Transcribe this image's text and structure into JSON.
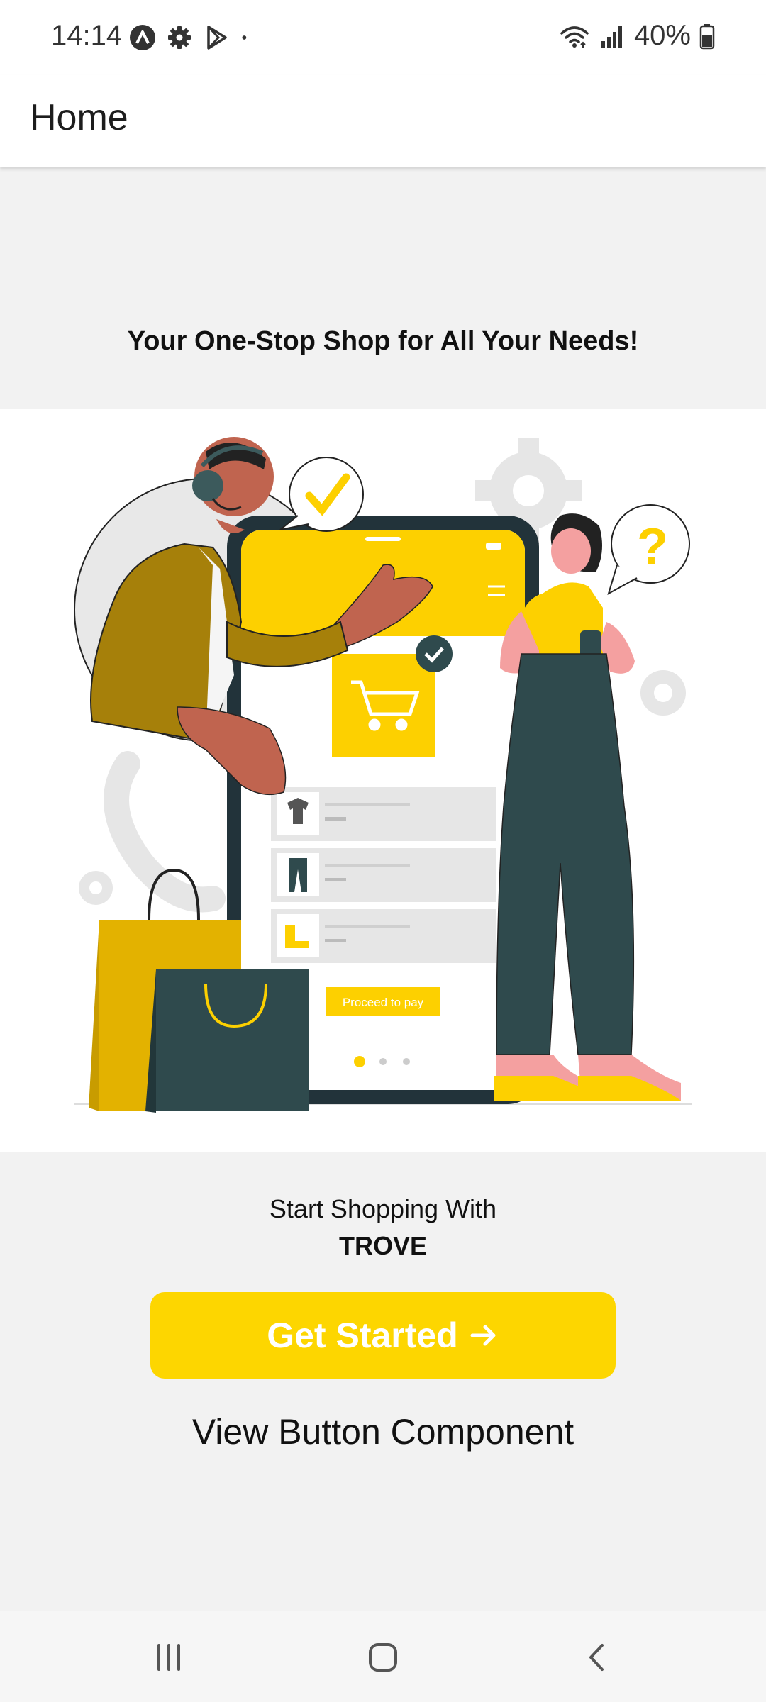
{
  "status_bar": {
    "time": "14:14",
    "battery": "40%",
    "left_icons": [
      "assistant-icon",
      "settings-gear-icon",
      "play-store-icon",
      "notification-dot-icon"
    ],
    "right_icons": [
      "wifi-icon",
      "cell-signal-icon",
      "battery-icon"
    ]
  },
  "header": {
    "title": "Home"
  },
  "main": {
    "tagline": "Your One-Stop Shop for All Your Needs!",
    "illustration": {
      "proceed_label": "Proceed to pay"
    },
    "start_text": "Start Shopping With",
    "brand": "TROVE",
    "get_started_label": "Get Started",
    "view_button_label": "View Button Component"
  },
  "colors": {
    "accent": "#fdd600",
    "background": "#f2f2f2",
    "header": "#ffffff",
    "dark_teal": "#2f4a4d",
    "ochre": "#a6800a"
  },
  "nav_bar": {
    "icons": [
      "recents-icon",
      "home-icon",
      "back-icon"
    ]
  }
}
